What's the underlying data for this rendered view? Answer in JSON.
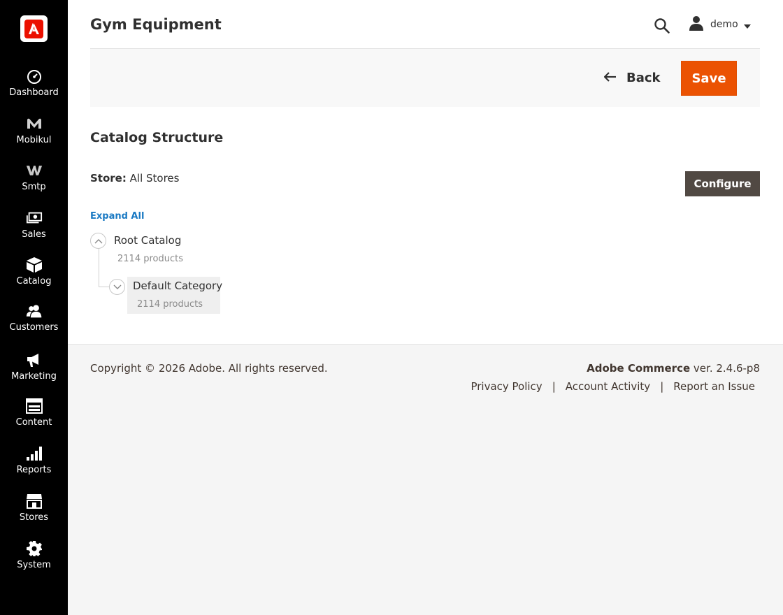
{
  "header": {
    "page_title": "Gym Equipment",
    "user_name": "demo"
  },
  "toolbar": {
    "back_label": "Back",
    "save_label": "Save"
  },
  "sidebar": {
    "items": [
      {
        "label": "Dashboard",
        "icon": "speedometer-icon"
      },
      {
        "label": "Mobikul",
        "icon": "mobikul-icon"
      },
      {
        "label": "Smtp",
        "icon": "smtp-icon"
      },
      {
        "label": "Sales",
        "icon": "sales-icon"
      },
      {
        "label": "Catalog",
        "icon": "catalog-box-icon"
      },
      {
        "label": "Customers",
        "icon": "customers-icon"
      },
      {
        "label": "Marketing",
        "icon": "megaphone-icon"
      },
      {
        "label": "Content",
        "icon": "content-layout-icon"
      },
      {
        "label": "Reports",
        "icon": "bar-chart-icon"
      },
      {
        "label": "Stores",
        "icon": "store-icon"
      },
      {
        "label": "System",
        "icon": "gear-icon"
      }
    ]
  },
  "catalog": {
    "section_title": "Catalog Structure",
    "store_key": "Store:",
    "store_value": "All Stores",
    "configure_label": "Configure",
    "expand_all": "Expand All",
    "tree": [
      {
        "label": "Root Catalog",
        "count": "2114 products"
      },
      {
        "label": "Default Category",
        "count": "2114 products"
      }
    ]
  },
  "footer": {
    "copyright": "Copyright © 2026 Adobe. All rights reserved.",
    "brand": "Adobe Commerce",
    "version": "ver. 2.4.6-p8",
    "links": [
      "Privacy Policy",
      "Account Activity",
      "Report an Issue"
    ],
    "separator": "|"
  },
  "colors": {
    "accent": "#eb5202",
    "sidebar_bg": "#000000",
    "link": "#1979c3",
    "secondary_button": "#514943"
  }
}
